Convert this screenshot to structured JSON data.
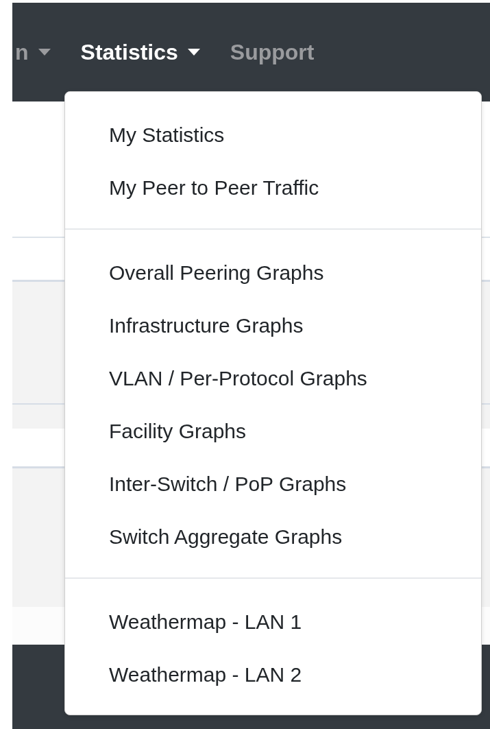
{
  "navbar": {
    "items": [
      {
        "label": "n",
        "caret": true,
        "active": false
      },
      {
        "label": "Statistics",
        "caret": true,
        "active": true
      },
      {
        "label": "Support",
        "caret": false,
        "active": false
      }
    ]
  },
  "dropdown": {
    "groups": [
      [
        "My Statistics",
        "My Peer to Peer Traffic"
      ],
      [
        "Overall Peering Graphs",
        "Infrastructure Graphs",
        "VLAN / Per-Protocol Graphs",
        "Facility Graphs",
        "Inter-Switch / PoP Graphs",
        "Switch Aggregate Graphs"
      ],
      [
        "Weathermap - LAN 1",
        "Weathermap - LAN 2"
      ]
    ]
  }
}
